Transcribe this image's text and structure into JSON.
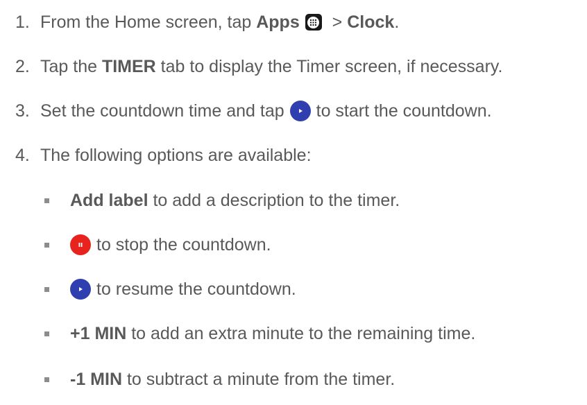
{
  "steps": [
    {
      "number": "1.",
      "pre": "From the Home screen, tap ",
      "bold1": "Apps",
      "icon": "apps-grid-icon",
      "mid": " > ",
      "bold2": "Clock",
      "post": "."
    },
    {
      "number": "2.",
      "pre": "Tap the ",
      "bold": "TIMER",
      "post": " tab to display the Timer screen, if necessary."
    },
    {
      "number": "3.",
      "pre": "Set the countdown time and tap",
      "icon": "play-icon",
      "post": "to start the countdown."
    },
    {
      "number": "4.",
      "text": "The following options are available:"
    }
  ],
  "options": [
    {
      "bold": "Add label",
      "text": " to add a description to the timer."
    },
    {
      "icon": "pause-icon",
      "text": "to stop the countdown."
    },
    {
      "icon": "play-icon",
      "text": "to resume the countdown."
    },
    {
      "bold": "+1 MIN",
      "text": " to add an extra minute to the remaining time."
    },
    {
      "bold": "-1 MIN",
      "text": " to subtract a minute from the timer."
    }
  ],
  "colors": {
    "text": "#595959",
    "play_button": "#2f3fb0",
    "pause_button": "#e8231e",
    "bullet": "#8c8c8c"
  }
}
